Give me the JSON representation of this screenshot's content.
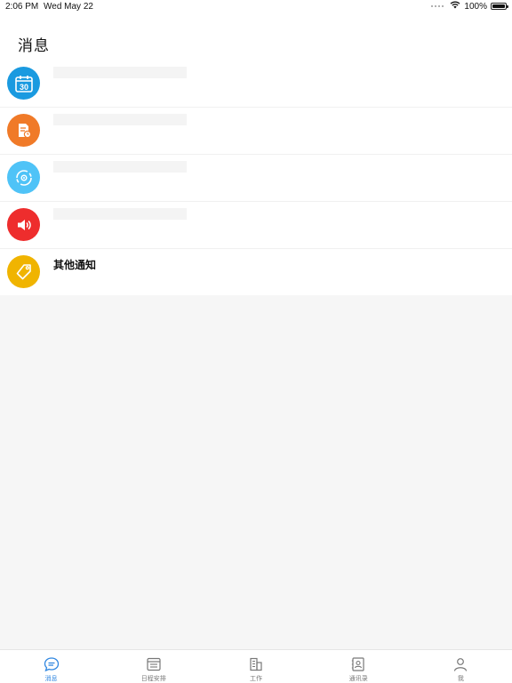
{
  "status_bar": {
    "time": "2:06 PM",
    "date": "Wed May 22",
    "battery": "100%"
  },
  "header": {
    "title": "消息"
  },
  "messages": [
    {
      "icon": "calendar-icon",
      "color": "#1a9ae0",
      "calendar_day": "30",
      "title": ""
    },
    {
      "icon": "document-clock-icon",
      "color": "#f07a28",
      "title": ""
    },
    {
      "icon": "settings-cycle-icon",
      "color": "#4fc3f7",
      "title": ""
    },
    {
      "icon": "speaker-icon",
      "color": "#ee2d2d",
      "title": ""
    },
    {
      "icon": "tag-icon",
      "color": "#f0b400",
      "title": "其他通知"
    }
  ],
  "tab_bar": {
    "active_color": "#2f86e0",
    "inactive_color": "#777777",
    "tabs": [
      {
        "label": "消息",
        "icon": "chat-bubble-icon",
        "active": true
      },
      {
        "label": "日程安排",
        "icon": "schedule-icon",
        "active": false
      },
      {
        "label": "工作",
        "icon": "building-icon",
        "active": false
      },
      {
        "label": "通讯录",
        "icon": "contacts-icon",
        "active": false
      },
      {
        "label": "我",
        "icon": "person-icon",
        "active": false
      }
    ]
  }
}
